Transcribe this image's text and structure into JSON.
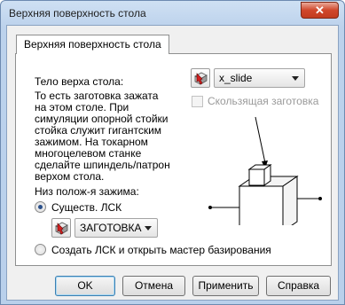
{
  "window": {
    "title": "Верхняя поверхность стола",
    "close_glyph": "✕"
  },
  "tab": {
    "label": "Верхняя поверхность стола"
  },
  "table_body": {
    "heading": "Тело верха стола:",
    "description": "То есть заготовка зажата\nна этом столе. При\nсимуляции опорной стойки\nстойка служит гигантским\nзажимом. На токарном\nмногоцелевом станке\nсделайте шпиндель/патрон\nверхом стола.",
    "body_select": {
      "value": "x_slide",
      "icon": "select-body-icon"
    },
    "sliding_checkbox": {
      "label": "Скользящая заготовка",
      "checked": false,
      "enabled": false
    }
  },
  "clamp": {
    "heading": "Низ полож-я зажима:",
    "options": [
      {
        "label": "Существ. ЛСК",
        "selected": true
      },
      {
        "label": "Создать ЛСК и открыть мастер базирования",
        "selected": false
      }
    ],
    "csys_select": {
      "value": "ЗАГОТОВКА",
      "icon": "select-csys-icon"
    }
  },
  "buttons": {
    "ok": "OK",
    "cancel": "Отмена",
    "apply": "Применить",
    "help": "Справка"
  },
  "colors": {
    "title_bar": "#bcd2ec",
    "close_button": "#d0472b",
    "radio_dot": "#2a4f8a"
  }
}
